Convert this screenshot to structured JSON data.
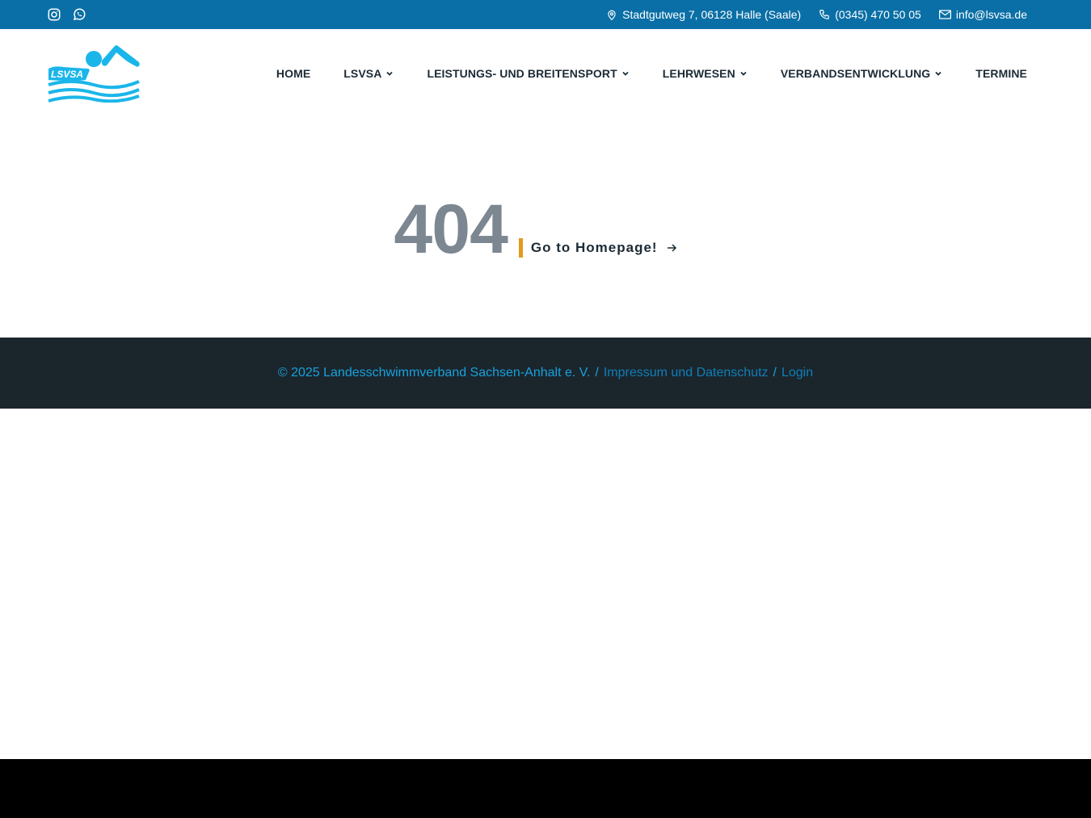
{
  "topbar": {
    "social": [
      {
        "icon": "instagram-icon"
      },
      {
        "icon": "whatsapp-icon"
      }
    ],
    "address": "Stadtgutweg 7, 06128 Halle (Saale)",
    "phone": "(0345) 470 50 05",
    "email": "info@lsvsa.de"
  },
  "header": {
    "logo_text": "LSVSA",
    "nav": [
      {
        "label": "HOME",
        "dropdown": false
      },
      {
        "label": "LSVSA",
        "dropdown": true
      },
      {
        "label": "LEISTUNGS- UND BREITENSPORT",
        "dropdown": true
      },
      {
        "label": "LEHRWESEN",
        "dropdown": true
      },
      {
        "label": "VERBANDSENTWICKLUNG",
        "dropdown": true
      },
      {
        "label": "TERMINE",
        "dropdown": false
      }
    ]
  },
  "main": {
    "error_code": "404",
    "home_link": "Go to Homepage!"
  },
  "footer": {
    "copyright": "© 2025 Landesschwimmverband Sachsen-Anhalt e. V.",
    "separator": "/",
    "impressum": "Impressum und Datenschutz",
    "login": "Login"
  },
  "colors": {
    "topbar_bg": "#0a6fa6",
    "footer_bg": "#1b252c",
    "accent": "#e39b1c",
    "link_blue": "#16a2dc",
    "logo_blue": "#1ab6ea"
  }
}
